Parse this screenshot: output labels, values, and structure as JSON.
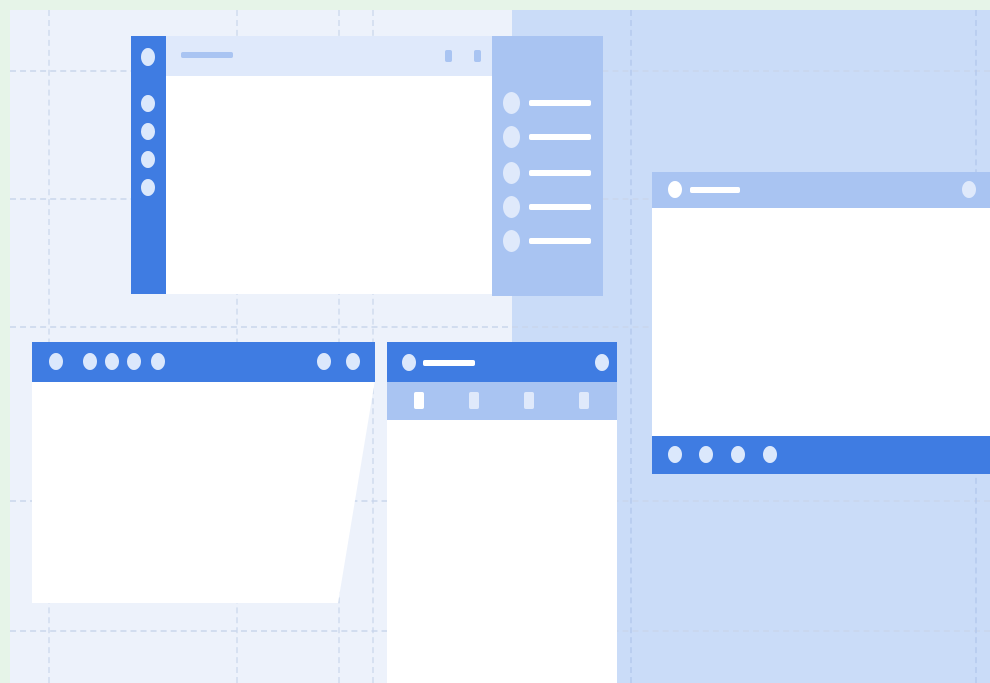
{
  "colors": {
    "page_frame": "#e6f4e8",
    "canvas_bg": "#edf2fb",
    "right_panel_bg": "#cadcf8",
    "grid_line": "#c9d6ec",
    "grid_line_on_panel": "#b1c6ec",
    "accent_blue": "#3f7ce2",
    "light_blue": "#a9c4f2",
    "pale_blue": "#dfe9fb",
    "white": "#ffffff",
    "dot_light": "#dbe8fc"
  },
  "layouts": [
    {
      "name": "layout-left-sidebar-right-list",
      "sidebar_icon_count": 5,
      "header_icon_count": 2,
      "list_item_count": 5
    },
    {
      "name": "layout-top-nav-window",
      "left_icon_count": 4,
      "right_icon_count": 2
    },
    {
      "name": "layout-header-tabs-window",
      "tab_count": 4
    },
    {
      "name": "layout-content-with-bottom-bar",
      "bottom_icon_count": 4
    }
  ]
}
